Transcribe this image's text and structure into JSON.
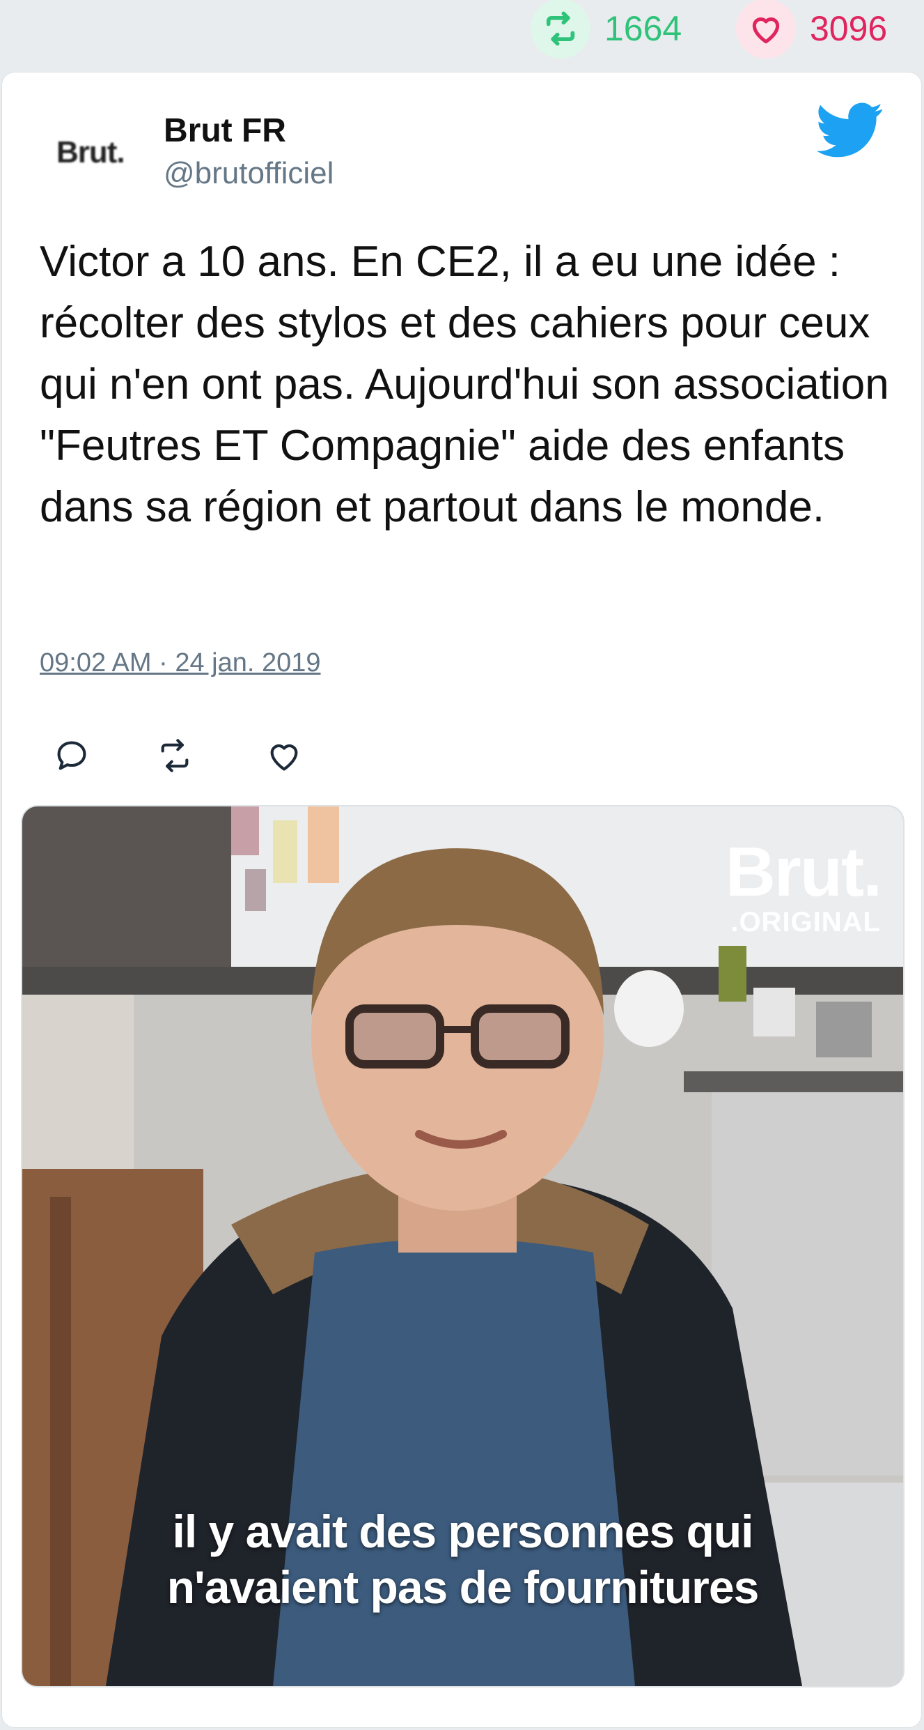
{
  "stats": {
    "retweet_count": "1664",
    "like_count": "3096",
    "retweet_color": "#2fc37a",
    "like_color": "#e0245e"
  },
  "tweet": {
    "author_name": "Brut FR",
    "author_handle": "@brutofficiel",
    "avatar_text": "Brut.",
    "text": "Victor a 10 ans. En CE2, il a eu une idée : récolter des stylos et des cahiers pour ceux qui n'en ont pas. Aujourd'hui son association \"Feutres ET Compagnie\" aide des enfants dans sa région et partout dans le monde.",
    "timestamp": "09:02 AM · 24 jan. 2019",
    "brand_icon": "twitter-bird-icon",
    "brand_color": "#1da1f2",
    "actions": [
      "reply-icon",
      "retweet-icon",
      "like-icon"
    ]
  },
  "media": {
    "watermark_brand": "Brut.",
    "watermark_sub": ".ORIGINAL",
    "subtitle_line1": "il y avait des personnes qui",
    "subtitle_line2": "n'avaient pas de fournitures"
  }
}
